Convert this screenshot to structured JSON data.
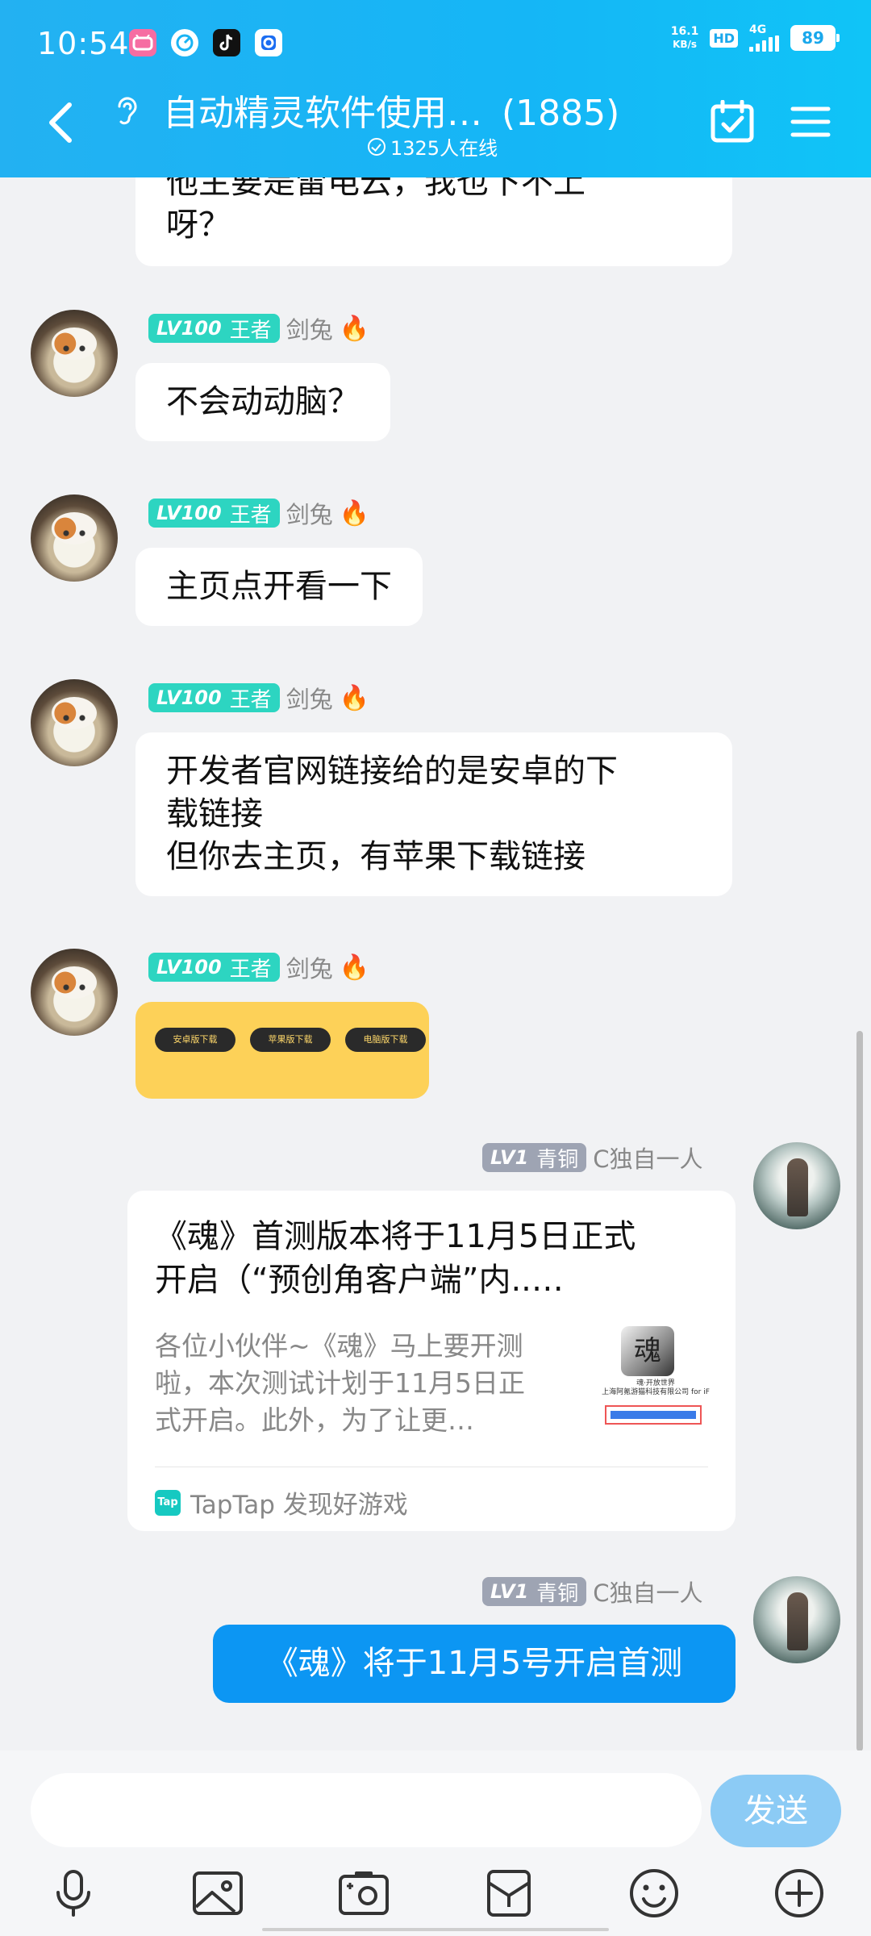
{
  "status_bar": {
    "time": "10:54",
    "net_speed_value": "16.1",
    "net_speed_unit": "KB/s",
    "hd": "HD",
    "network": "4G",
    "battery": "89",
    "app_icons": [
      "bilibili-icon",
      "speed-icon",
      "tiktok-icon",
      "app-icon"
    ]
  },
  "header": {
    "title": "自动精灵软件使用…",
    "member_count": "(1885)",
    "online": "1325人在线"
  },
  "messages": [
    {
      "type": "text",
      "side": "left",
      "text_lines": [
        "他主要是雷电云，我也下不上",
        "呀？"
      ]
    },
    {
      "type": "text",
      "side": "left",
      "avatar": "cat-avatar",
      "level": "LV100",
      "rank": "王者",
      "sender": "剑兔",
      "badge_icon": "fire-icon",
      "text_lines": [
        "不会动动脑？"
      ]
    },
    {
      "type": "text",
      "side": "left",
      "avatar": "cat-avatar",
      "level": "LV100",
      "rank": "王者",
      "sender": "剑兔",
      "badge_icon": "fire-icon",
      "text_lines": [
        "主页点开看一下"
      ]
    },
    {
      "type": "text",
      "side": "left",
      "avatar": "cat-avatar",
      "level": "LV100",
      "rank": "王者",
      "sender": "剑兔",
      "badge_icon": "fire-icon",
      "text_lines": [
        "开发者官网链接给的是安卓的下",
        "载链接",
        "但你去主页，有苹果下载链接"
      ]
    },
    {
      "type": "image",
      "side": "left",
      "avatar": "cat-avatar",
      "level": "LV100",
      "rank": "王者",
      "sender": "剑兔",
      "badge_icon": "fire-icon",
      "buttons": [
        "安卓版下载",
        "苹果版下载",
        "电脑版下载"
      ],
      "background": "#fdd158"
    },
    {
      "type": "link",
      "side": "right",
      "avatar": "girl-avatar",
      "level": "LV1",
      "rank": "青铜",
      "sender": "C独自一人",
      "title_lines": [
        "《魂》首测版本将于11月5日正式",
        "开启（“预创角客户端”内..…"
      ],
      "desc_lines": [
        "各位小伙伴~《魂》马上要开测",
        "啦，本次测试计划于11月5日正",
        "式开启。此外，为了让更…"
      ],
      "thumb_logo": "魂",
      "thumb_caption": "魂·开放世界",
      "thumb_company": "上海阿氪游猫科技有限公司 for iF",
      "source": "TapTap 发现好游戏",
      "source_icon": "Tap"
    },
    {
      "type": "text",
      "side": "right",
      "avatar": "girl-avatar",
      "level": "LV1",
      "rank": "青铜",
      "sender": "C独自一人",
      "text_lines": [
        "《魂》将于11月5号开启首测"
      ]
    }
  ],
  "input": {
    "value": "",
    "send_label": "发送"
  },
  "toolbar": [
    "microphone-icon",
    "image-icon",
    "camera-icon",
    "folder-icon",
    "emoji-icon",
    "plus-icon"
  ],
  "colors": {
    "header": "#1ab4f4",
    "sent_bubble": "#0c96f3",
    "level_badge_high": "#2dd5c1",
    "level_badge_low": "#9ea4b3",
    "send_button": "#8ccbf5"
  }
}
